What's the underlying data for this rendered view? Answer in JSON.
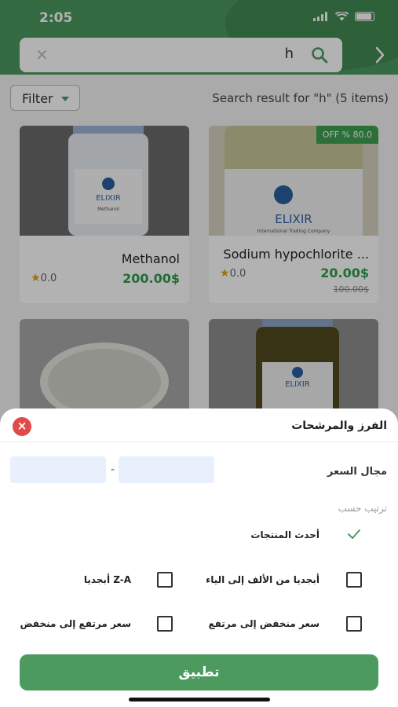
{
  "status": {
    "time": "2:05"
  },
  "search": {
    "query": "h",
    "clear_icon": "×"
  },
  "toolbar": {
    "filter_label": "Filter",
    "result_text": "Search result for \"h\" (5 items)"
  },
  "products": [
    {
      "title": "Methanol",
      "price": "200.00$",
      "rating": "0.0",
      "old_price": "",
      "badge": ""
    },
    {
      "title": "Sodium hypochlorite ...",
      "price": "20.00$",
      "rating": "0.0",
      "old_price": "100.00$",
      "badge": "OFF % 80.0"
    },
    {
      "title": "",
      "price": "",
      "rating": "",
      "old_price": "",
      "badge": ""
    },
    {
      "title": "",
      "price": "",
      "rating": "",
      "old_price": "",
      "badge": ""
    }
  ],
  "sheet": {
    "close_icon": "×",
    "title": "الفرز والمرشحات",
    "price_range_label": "مجال السعر",
    "price_dash": "-",
    "sort_label": "ترتيب حسب",
    "options": {
      "newest": "أحدث المنتجات",
      "alpha_az": "أبجديا من الألف إلى الياء",
      "alpha_za": "أبجديا Z-A",
      "price_low_high": "سعر منخفض إلى مرتفع",
      "price_high_low": "سعر مرتفع إلى منخفض"
    },
    "selected_option": "newest",
    "apply_label": "تطبيق"
  },
  "colors": {
    "brand": "#4d9a5f",
    "price": "#2e9e4c",
    "close": "#e04a4a"
  }
}
